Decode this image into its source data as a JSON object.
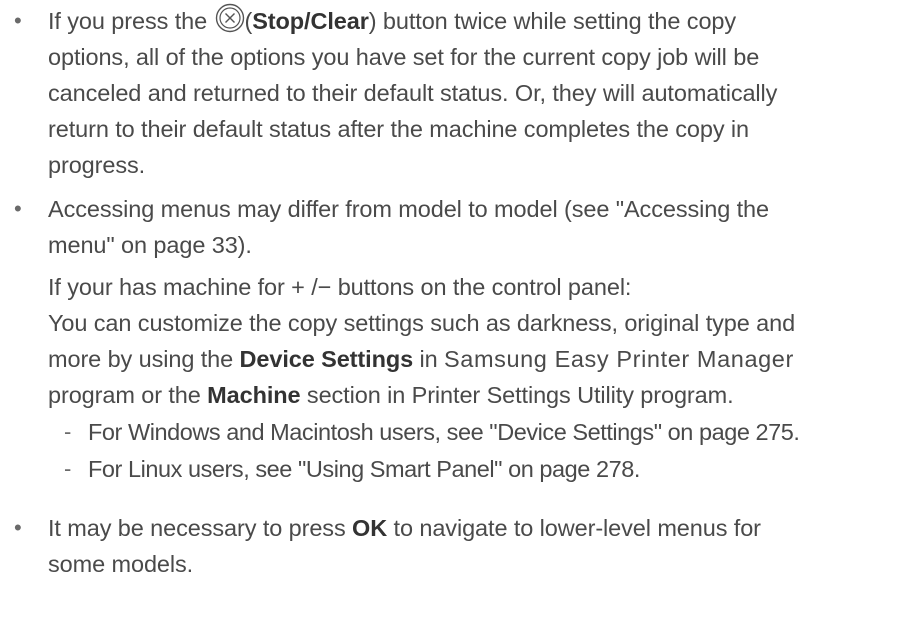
{
  "bullets": [
    {
      "lines": [
        {
          "a": "If you press the ",
          "b": "(",
          "bold": "Stop/Clear",
          "c": ") button twice while setting the copy"
        },
        "options, all of the options you have set for the current copy job will be",
        "canceled and returned to their default status. Or, they will automatically",
        "return to their default status after the machine completes the copy in",
        "progress."
      ]
    },
    {
      "lines": [
        "Accessing menus may differ from model to model (see \"Accessing the",
        "menu\" on page 33)."
      ],
      "extra": {
        "line1": "If your has machine for + /− buttons on the control panel:",
        "line2": "You can customize the copy settings such as darkness, original type and",
        "line3": {
          "pre": "more by using the ",
          "bold": "Device Settings",
          "mid": " in ",
          "wide": "Samsung Easy Printer Manager"
        },
        "line4": {
          "pre": "program or the ",
          "bold": "Machine",
          "post": " section in Printer Settings Utility program."
        }
      },
      "subitems": [
        "For Windows and Macintosh users, see \"Device Settings\" on page 275.",
        "For Linux users, see \"Using Smart Panel\" on page 278."
      ]
    },
    {
      "lines": [
        {
          "pre": "It may be necessary to press ",
          "bold": "OK",
          "post": " to navigate to lower-level menus for"
        },
        "some models."
      ]
    }
  ],
  "icons": {
    "bullet": "•",
    "dash": "-",
    "stop_clear": "stop-clear-icon"
  },
  "colors": {
    "text": "#4a4a4a",
    "bold_text": "#333333"
  }
}
